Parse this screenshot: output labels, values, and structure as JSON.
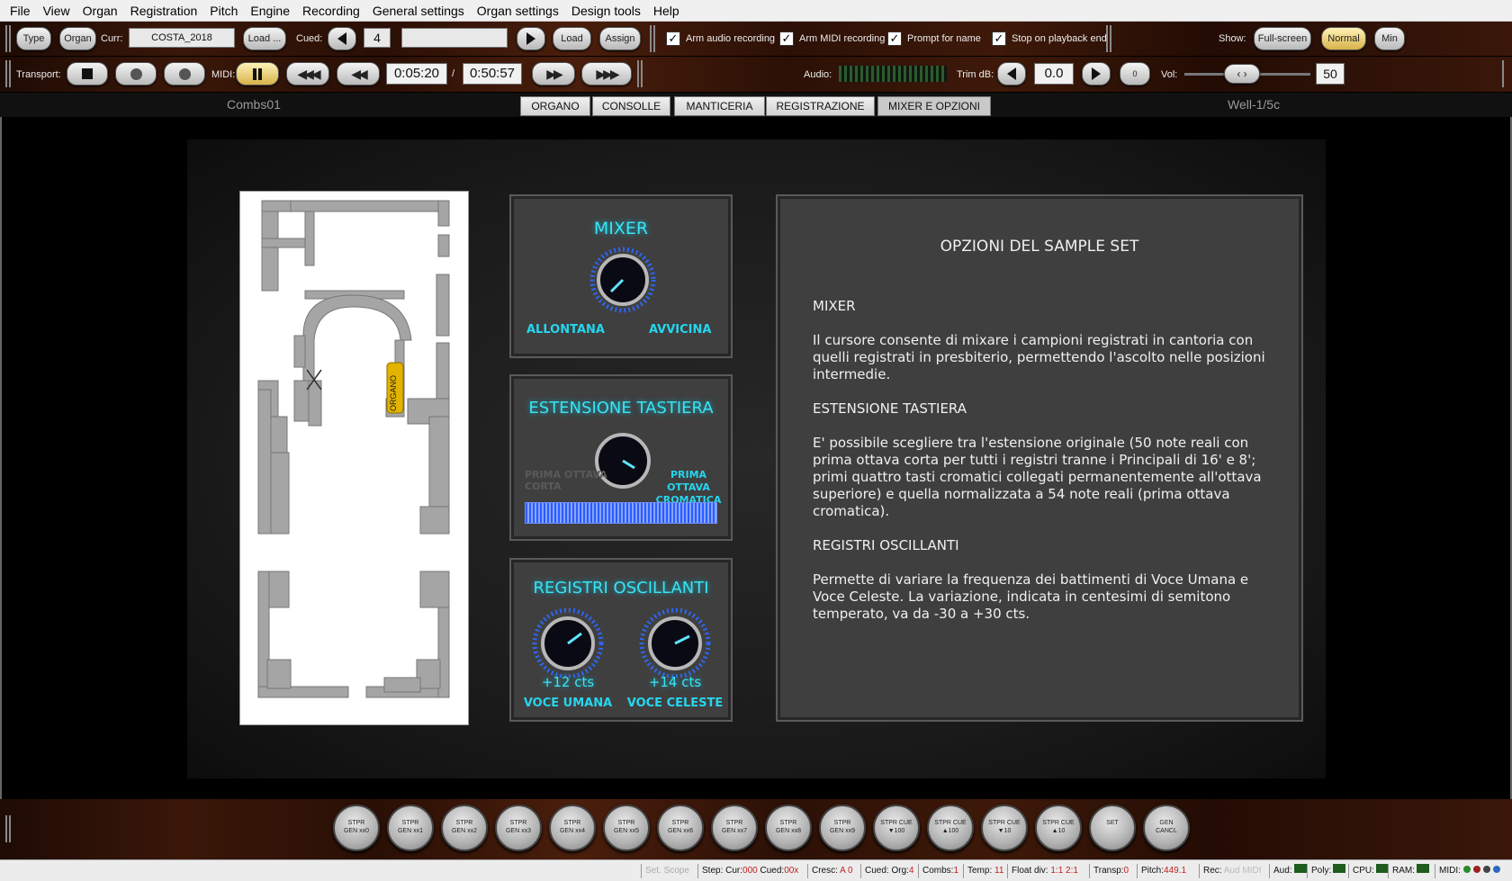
{
  "menu": [
    "File",
    "View",
    "Organ",
    "Registration",
    "Pitch",
    "Engine",
    "Recording",
    "General settings",
    "Organ settings",
    "Design tools",
    "Help"
  ],
  "toolbar1": {
    "type_btn": "Type",
    "organ_btn": "Organ",
    "curr_label": "Curr:",
    "curr_value": "COSTA_2018",
    "load_btn": "Load ...",
    "cued_label": "Cued:",
    "cued_value": "4",
    "load2_btn": "Load",
    "assign_btn": "Assign",
    "checks": [
      {
        "label": "Arm audio recording",
        "checked": true
      },
      {
        "label": "Arm MIDI recording",
        "checked": true
      },
      {
        "label": "Prompt for name",
        "checked": true
      },
      {
        "label": "Stop on playback end",
        "checked": true
      }
    ],
    "show_label": "Show:",
    "fullscreen_btn": "Full-screen",
    "normal_btn": "Normal",
    "min_btn": "Min"
  },
  "toolbar2": {
    "transport_label": "Transport:",
    "midi_label": "MIDI:",
    "time_current": "0:05:20",
    "time_sep": "/",
    "time_total": "0:50:57",
    "audio_label": "Audio:",
    "trim_label": "Trim dB:",
    "trim_value": "0.0",
    "zero_btn": "0",
    "vol_label": "Vol:",
    "vol_value": "50"
  },
  "tabs": {
    "left_label": "Combs01",
    "items": [
      "ORGANO",
      "CONSOLLE",
      "MANTICERIA",
      "REGISTRAZIONE",
      "MIXER E OPZIONI"
    ],
    "active": "MIXER E OPZIONI",
    "right_label": "Well-1/5c"
  },
  "floorplan": {
    "organ_label": "ORGANO"
  },
  "mixer": {
    "title": "MIXER",
    "left": "ALLONTANA",
    "right": "AVVICINA"
  },
  "keyboard": {
    "title": "ESTENSIONE TASTIERA",
    "left_line1": "PRIMA OTTAVA",
    "left_line2": "CORTA",
    "right_line1": "PRIMA OTTAVA",
    "right_line2": "CROMATICA"
  },
  "oscillating": {
    "title": "REGISTRI OSCILLANTI",
    "knob1_value": "+12 cts",
    "knob1_label": "VOCE UMANA",
    "knob2_value": "+14 cts",
    "knob2_label": "VOCE CELESTE"
  },
  "info": {
    "title": "OPZIONI DEL SAMPLE SET",
    "h1": "MIXER",
    "p1": "Il cursore  consente di mixare i campioni registrati in cantoria con quelli registrati in presbiterio, permettendo l'ascolto nelle posizioni intermedie.",
    "h2": "ESTENSIONE TASTIERA",
    "p2": "E' possibile scegliere tra  l'estensione originale (50 note reali con prima ottava corta per tutti i registri tranne i Principali di 16' e 8'; primi quattro tasti cromatici collegati permanentemente all'ottava superiore) e quella normalizzata a 54 note reali (prima ottava cromatica).",
    "h3": "REGISTRI OSCILLANTI",
    "p3": "Permette di variare la frequenza dei battimenti di Voce Umana e Voce Celeste. La variazione, indicata in centesimi di semitono temperato, va da -30 a +30 cts."
  },
  "stop_buttons": [
    {
      "l1": "STPR",
      "l2": "GEN xx0"
    },
    {
      "l1": "STPR",
      "l2": "GEN xx1"
    },
    {
      "l1": "STPR",
      "l2": "GEN xx2"
    },
    {
      "l1": "STPR",
      "l2": "GEN xx3"
    },
    {
      "l1": "STPR",
      "l2": "GEN xx4"
    },
    {
      "l1": "STPR",
      "l2": "GEN xx5"
    },
    {
      "l1": "STPR",
      "l2": "GEN xx6"
    },
    {
      "l1": "STPR",
      "l2": "GEN xx7"
    },
    {
      "l1": "STPR",
      "l2": "GEN xx8"
    },
    {
      "l1": "STPR",
      "l2": "GEN xx9"
    },
    {
      "l1": "STPR CUE",
      "l2": "▼100"
    },
    {
      "l1": "STPR CUE",
      "l2": "▲100"
    },
    {
      "l1": "STPR CUE",
      "l2": "▼10"
    },
    {
      "l1": "STPR CUE",
      "l2": "▲10"
    },
    {
      "l1": "",
      "l2": "SET"
    },
    {
      "l1": "GEN",
      "l2": "CANCL"
    }
  ],
  "status": {
    "set_scope": "Set. Scope",
    "step": "Step: Cur:",
    "step_cur": "000",
    "step_cued": " Cued:",
    "step_cued_v": "00x",
    "cresc": "Cresc:",
    "cresc_v": "A 0",
    "cued_org": "Cued: Org:",
    "cued_org_v": "4",
    "combs": "Combs:",
    "combs_v": "1",
    "temp": "Temp:",
    "temp_v": "11",
    "float": "Float div:",
    "float_v": "1:1 2:1",
    "transp": "Transp:",
    "transp_v": "0",
    "pitch": "Pitch:",
    "pitch_v": "449.1",
    "rec": "Rec:",
    "rec_v": "Aud MIDI",
    "aud": "Aud:",
    "poly": "Poly:",
    "cpu": "CPU:",
    "ram": "RAM:",
    "midi": "MIDI:"
  }
}
